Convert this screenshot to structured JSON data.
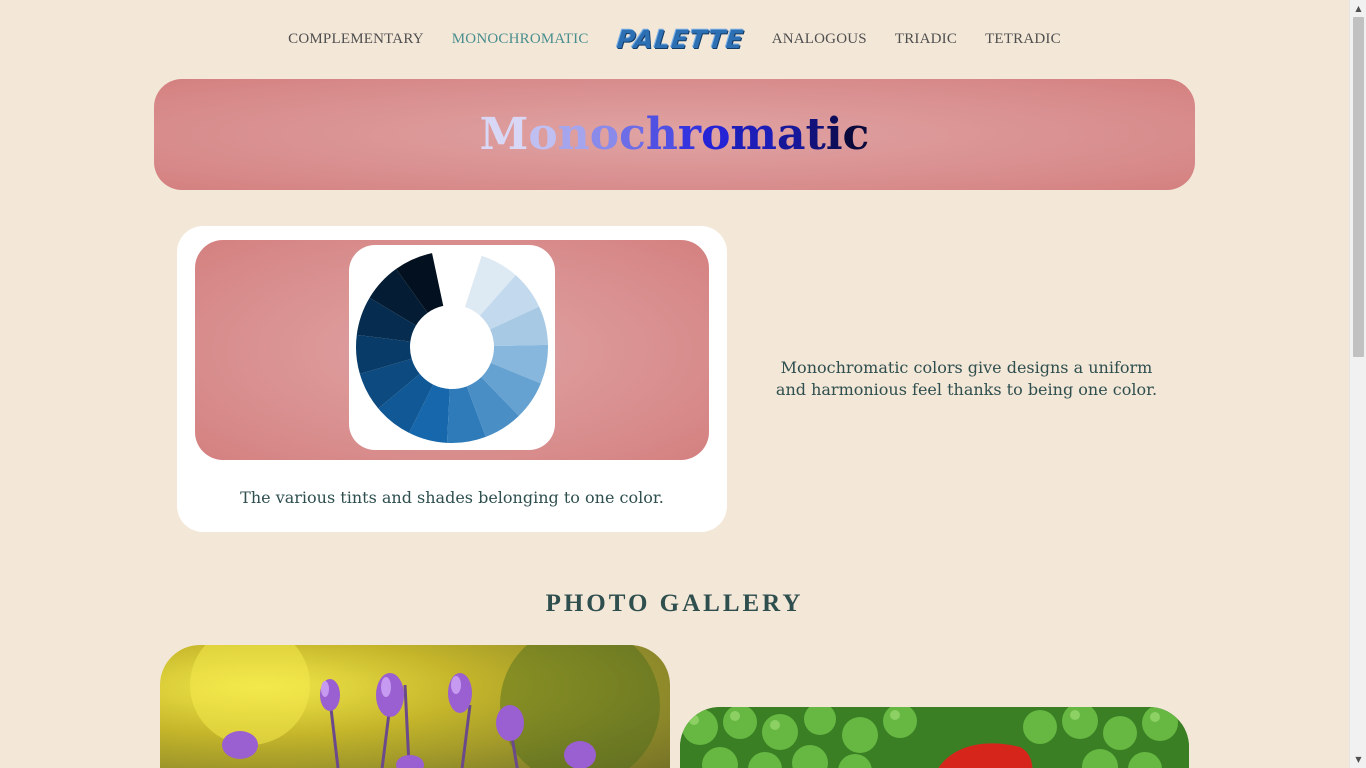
{
  "nav": {
    "items": [
      {
        "label": "COMPLEMENTARY",
        "active": false
      },
      {
        "label": "MONOCHROMATIC",
        "active": true
      },
      {
        "label": "PALETTE",
        "logo": true
      },
      {
        "label": "ANALOGOUS",
        "active": false
      },
      {
        "label": "TRIADIC",
        "active": false
      },
      {
        "label": "TETRADIC",
        "active": false
      }
    ]
  },
  "hero": {
    "title": "Monochromatic",
    "letter_colors": [
      "#d8d8f6",
      "#bfbff2",
      "#a5a5ee",
      "#8a8aea",
      "#6d6de7",
      "#5050e3",
      "#3535df",
      "#2424d6",
      "#1d1db8",
      "#17179a",
      "#12127a",
      "#0d0d5c",
      "#0a0a3c"
    ]
  },
  "card": {
    "caption": "The various tints and shades belonging to one color.",
    "wheel_colors": [
      "#dde9f3",
      "#c3d9ed",
      "#a7c9e4",
      "#87b7dc",
      "#66a2d1",
      "#4a8ec6",
      "#2f7bba",
      "#1667ab",
      "#105896",
      "#0c4a7f",
      "#083b67",
      "#062d50",
      "#041d35",
      "#02101f"
    ]
  },
  "description": "Monochromatic colors give designs a uniform and harmonious feel thanks to being one color.",
  "gallery": {
    "title": "PHOTO GALLERY"
  },
  "colors": {
    "background": "#f3e7d7",
    "accent_pink": "#d88c8c",
    "nav_active": "#4a8f8f",
    "logo_blue": "#2d6fb3"
  }
}
